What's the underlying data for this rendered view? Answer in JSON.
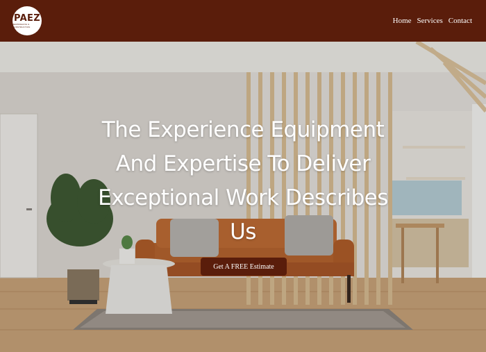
{
  "brand": {
    "logo_text": "PAEZ",
    "logo_subtext": "REMODELING & CONSTRUCTION"
  },
  "nav": {
    "items": [
      "Home",
      "Services",
      "Contact"
    ]
  },
  "hero": {
    "headline": "The Experience Equipment And Expertise To Deliver Exceptional Work Describes Us",
    "cta_label": "Get A FREE Estimate"
  },
  "colors": {
    "brand": "#5a1d0b",
    "text_light": "#ffffff"
  }
}
